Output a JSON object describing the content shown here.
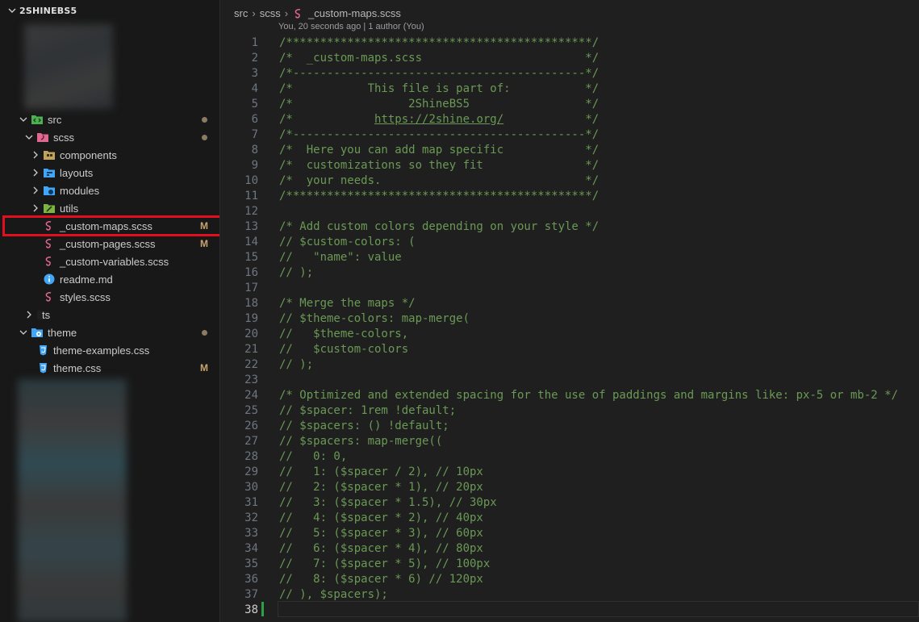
{
  "explorer": {
    "root_title": "2SHINEBS5",
    "items": [
      {
        "label": "src",
        "icon": "folder-src-icon",
        "decoration": "dot",
        "expanded": true
      },
      {
        "label": "scss",
        "icon": "folder-sass-icon",
        "decoration": "dot",
        "expanded": true
      },
      {
        "label": "components",
        "icon": "folder-components-icon",
        "decoration": ""
      },
      {
        "label": "layouts",
        "icon": "folder-layouts-icon",
        "decoration": ""
      },
      {
        "label": "modules",
        "icon": "folder-modules-icon",
        "decoration": ""
      },
      {
        "label": "utils",
        "icon": "folder-utils-icon",
        "decoration": ""
      },
      {
        "label": "_custom-maps.scss",
        "icon": "sass-file-icon",
        "decoration": "M"
      },
      {
        "label": "_custom-pages.scss",
        "icon": "sass-file-icon",
        "decoration": "M"
      },
      {
        "label": "_custom-variables.scss",
        "icon": "sass-file-icon",
        "decoration": ""
      },
      {
        "label": "readme.md",
        "icon": "info-file-icon",
        "decoration": ""
      },
      {
        "label": "styles.scss",
        "icon": "sass-file-icon",
        "decoration": ""
      },
      {
        "label": "ts",
        "icon": "folder-ts-icon",
        "decoration": ""
      },
      {
        "label": "theme",
        "icon": "folder-theme-icon",
        "decoration": "dot",
        "expanded": true
      },
      {
        "label": "theme-examples.css",
        "icon": "css-file-icon",
        "decoration": ""
      },
      {
        "label": "theme.css",
        "icon": "css-file-icon",
        "decoration": "M"
      }
    ],
    "modified_marker": "M"
  },
  "editor": {
    "breadcrumb": [
      "src",
      "scss",
      "_custom-maps.scss"
    ],
    "blame": "You, 20 seconds ago | 1 author (You)",
    "current_line": 38,
    "lines": [
      "/*********************************************/",
      "/*  _custom-maps.scss                        */",
      "/*-------------------------------------------*/",
      "/*           This file is part of:           */",
      "/*                 2ShineBS5                 */",
      "/*            https://2shine.org/            */",
      "/*-------------------------------------------*/",
      "/*  Here you can add map specific            */",
      "/*  customizations so they fit               */",
      "/*  your needs.                              */",
      "/*********************************************/",
      "",
      "/* Add custom colors depending on your style */",
      "// $custom-colors: (",
      "//   \"name\": value",
      "// );",
      "",
      "/* Merge the maps */",
      "// $theme-colors: map-merge(",
      "//   $theme-colors,",
      "//   $custom-colors",
      "// );",
      "",
      "/* Optimized and extended spacing for the use of paddings and margins like: px-5 or mb-2 */",
      "// $spacer: 1rem !default;",
      "// $spacers: () !default;",
      "// $spacers: map-merge((",
      "//   0: 0,",
      "//   1: ($spacer / 2), // 10px",
      "//   2: ($spacer * 1), // 20px",
      "//   3: ($spacer * 1.5), // 30px",
      "//   4: ($spacer * 2), // 40px",
      "//   5: ($spacer * 3), // 60px",
      "//   6: ($spacer * 4), // 80px",
      "//   7: ($spacer * 5), // 100px",
      "//   8: ($spacer * 6) // 120px",
      "// ), $spacers);",
      ""
    ],
    "link_text": "https://2shine.org/"
  },
  "colors": {
    "comment": "#6a9955",
    "modified": "#c9a26d",
    "highlight_box": "#e2101f",
    "sass": "#e0678f",
    "css": "#42a5f5"
  }
}
